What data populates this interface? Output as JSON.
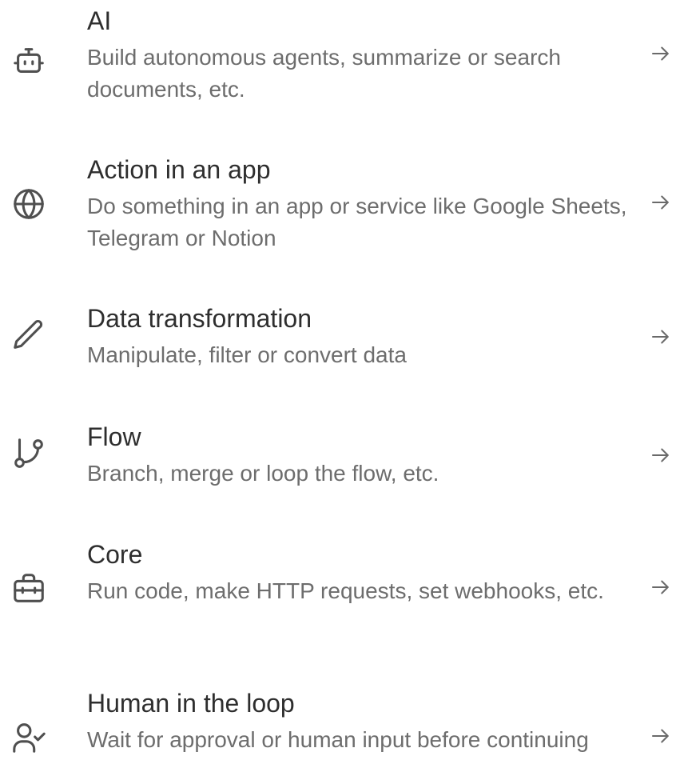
{
  "items": [
    {
      "title": "AI",
      "description": "Build autonomous agents, summarize or search documents, etc.",
      "icon": "robot-icon"
    },
    {
      "title": "Action in an app",
      "description": "Do something in an app or service like Google Sheets, Telegram or Notion",
      "icon": "globe-icon"
    },
    {
      "title": "Data transformation",
      "description": "Manipulate, filter or convert data",
      "icon": "pencil-icon"
    },
    {
      "title": "Flow",
      "description": "Branch, merge or loop the flow, etc.",
      "icon": "git-branch-icon"
    },
    {
      "title": "Core",
      "description": "Run code, make HTTP requests, set webhooks, etc.",
      "icon": "toolbox-icon"
    },
    {
      "title": "Human in the loop",
      "description": "Wait for approval or human input before continuing",
      "icon": "user-check-icon"
    }
  ],
  "colors": {
    "title": "#2e2e2e",
    "description": "#6d6d6d",
    "icon": "#4f4f4f",
    "background": "#ffffff"
  }
}
